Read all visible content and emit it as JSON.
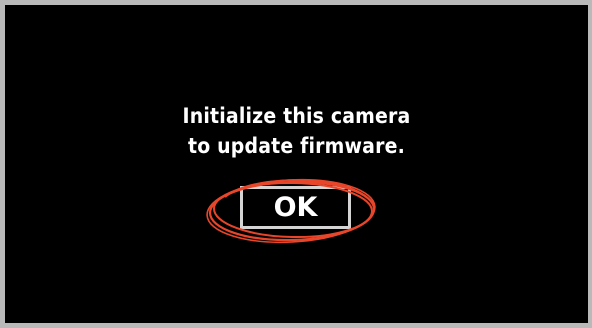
{
  "dialog": {
    "message_lines": [
      "Initialize this camera",
      "to update firmware."
    ],
    "ok_label": "OK"
  },
  "colors": {
    "screen_background": "#000000",
    "frame": "#b9b9b9",
    "text": "#ffffff",
    "button_border": "#d4d4d4",
    "highlight": "#e8462a"
  },
  "icons": {
    "highlight": "hand-drawn-circle-annotation"
  }
}
